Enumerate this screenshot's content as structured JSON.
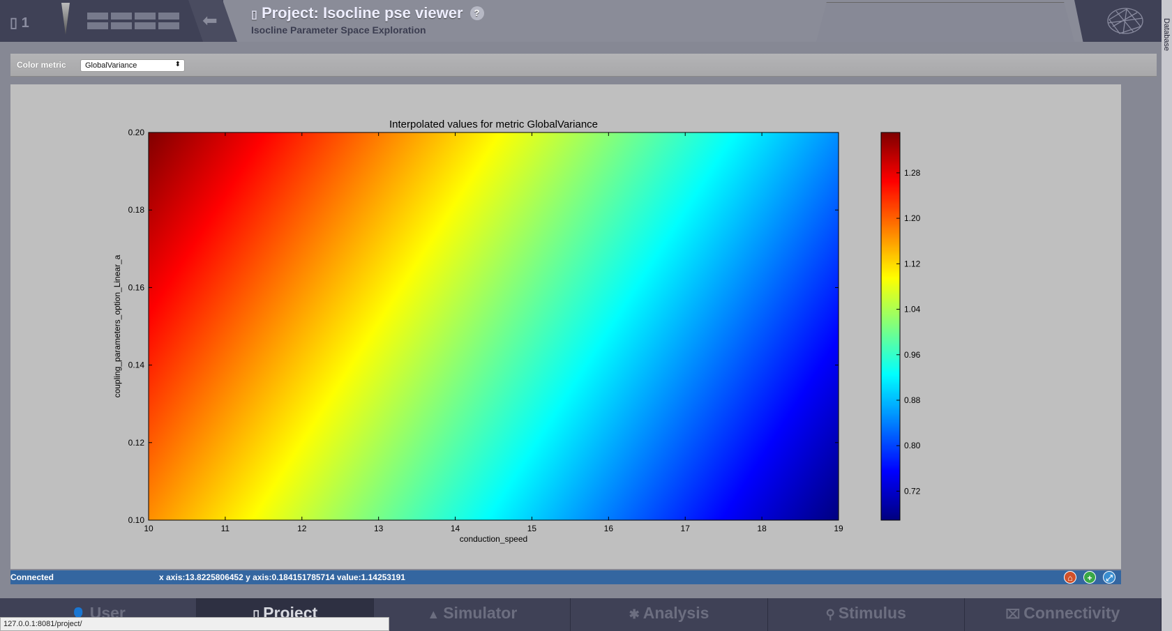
{
  "header": {
    "badge": "1",
    "title": "Project: Isocline pse viewer",
    "subtitle": "Isocline Parameter Space Exploration",
    "help": "?"
  },
  "side_tab": "Database",
  "toolbar": {
    "label": "Color metric",
    "selected": "GlobalVariance"
  },
  "status": {
    "state": "Connected",
    "readout": "x axis:13.8225806452 y axis:0.184151785714 value:1.14253191"
  },
  "nav": [
    "User",
    "Project",
    "Simulator",
    "Analysis",
    "Stimulus",
    "Connectivity"
  ],
  "nav_icons": [
    "user-icon",
    "document-icon",
    "simulator-icon",
    "gear-icon",
    "pin-icon",
    "connectivity-icon"
  ],
  "url_tooltip": "127.0.0.1:8081/project/",
  "chart_data": {
    "type": "heatmap",
    "title": "Interpolated values for metric GlobalVariance",
    "xlabel": "conduction_speed",
    "ylabel": "coupling_parameters_option_Linear_a",
    "xlim": [
      10,
      19
    ],
    "ylim": [
      0.1,
      0.2
    ],
    "xticks": [
      "10",
      "11",
      "12",
      "13",
      "14",
      "15",
      "16",
      "17",
      "18",
      "19"
    ],
    "yticks": [
      "0.10",
      "0.12",
      "0.14",
      "0.16",
      "0.18",
      "0.20"
    ],
    "colorbar": {
      "colormap": "jet",
      "range": [
        0.669,
        1.351
      ],
      "ticks": [
        "0.72",
        "0.80",
        "0.88",
        "0.96",
        "1.04",
        "1.12",
        "1.20",
        "1.28"
      ]
    },
    "corner_values": {
      "x10_y0.10": 1.17,
      "x19_y0.10": 0.67,
      "x10_y0.20": 1.35,
      "x19_y0.20": 0.85
    }
  }
}
